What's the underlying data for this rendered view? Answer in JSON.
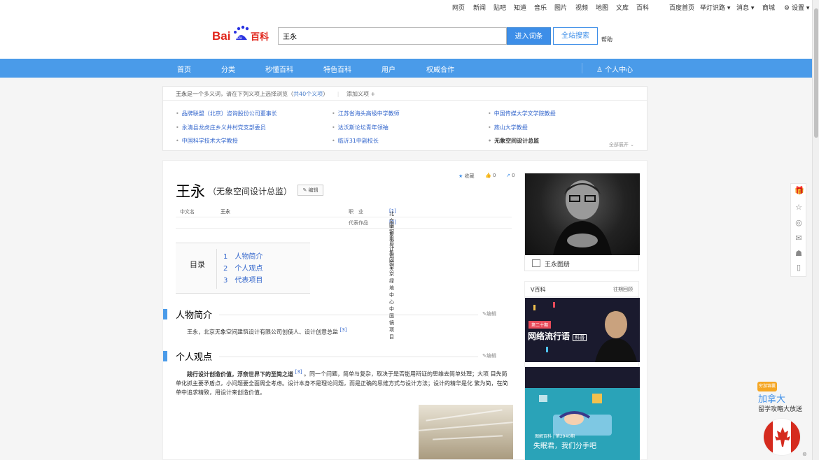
{
  "topbar": {
    "links": [
      "网页",
      "新闻",
      "贴吧",
      "知道",
      "音乐",
      "图片",
      "视频",
      "地图",
      "文库",
      "百科"
    ],
    "right": [
      "百度首页",
      "举灯识路",
      "消息",
      "商城",
      "设置"
    ]
  },
  "header": {
    "search_value": "王永",
    "enter_label": "进入词条",
    "all_label": "全站搜索",
    "help": "帮助"
  },
  "nav": {
    "items": [
      "首页",
      "分类",
      "秒懂百科",
      "特色百科",
      "用户",
      "权威合作"
    ],
    "user_center": "个人中心"
  },
  "polysemy": {
    "prefix_name": "王永",
    "prefix_text": "是一个多义词，请在下列义项上选择浏览（",
    "count": "共40个义项",
    "suffix": "）",
    "add": "添加义项",
    "items": [
      "品牌联盟（北京）咨询股份公司董事长",
      "江苏省海头高级中学教师",
      "中国传媒大学文学院教授",
      "永清县龙虎庄乡义井村党支部委员",
      "达沃斯论坛青年领袖",
      "燕山大学教授",
      "中国科学技术大学教授",
      "临沂31中副校长",
      "无象空间设计总监"
    ],
    "expand": "全部展开"
  },
  "entry": {
    "title": "王永",
    "subtitle": "（无象空间设计总监）",
    "edit": "编辑",
    "collect": "收藏",
    "likes": "0",
    "shares": "0"
  },
  "info": {
    "name_label": "中文名",
    "name_value": "王永",
    "job_label": "职　业",
    "job_value": "北京无象设计创始人",
    "job_ref": "[1]",
    "works_label": "代表作品",
    "works_value": "国银电气集团望京绿地中心中国镜项目",
    "works_ref": "[2]"
  },
  "toc": {
    "label": "目录",
    "items": [
      "1　人物简介",
      "2　个人观点",
      "3　代表项目"
    ]
  },
  "sections": {
    "s1_title": "人物简介",
    "s1_text": "王永，北京无象空间建筑设计有限公司创使人、设计创意总监",
    "s1_ref": "[3]",
    "s2_title": "个人观点",
    "s2_bold": "践行设计创造价值，浮奈世界下的至简之道",
    "s2_ref": "[3]",
    "s2_text1": "。同一个问题，简单与复杂，取决于是否能用辩证的思维去简单处理；大项",
    "s2_text2": "目先简单化抓主要矛盾点，小问题要全面周全考虑。设计本身不是理论问题，而是正确的思维方式与设计方法；设计的精华是化",
    "s2_text3": "繁为简，在简单中追求精致，用设计来创造价值。",
    "edit": "编辑"
  },
  "side": {
    "album": "王永图册",
    "vbaike": "V百科",
    "history": "往期回顾",
    "card1_badge": "第二十期",
    "card1_title": "网络流行语",
    "card1_tag": "科普",
    "card2_cap1": "图解百科 | 第2940期",
    "card2_cap2": "失眠君，我们分手吧"
  },
  "ad": {
    "brand": "穷游锦囊",
    "title": "加拿大",
    "sub": "留学攻略大放送"
  }
}
